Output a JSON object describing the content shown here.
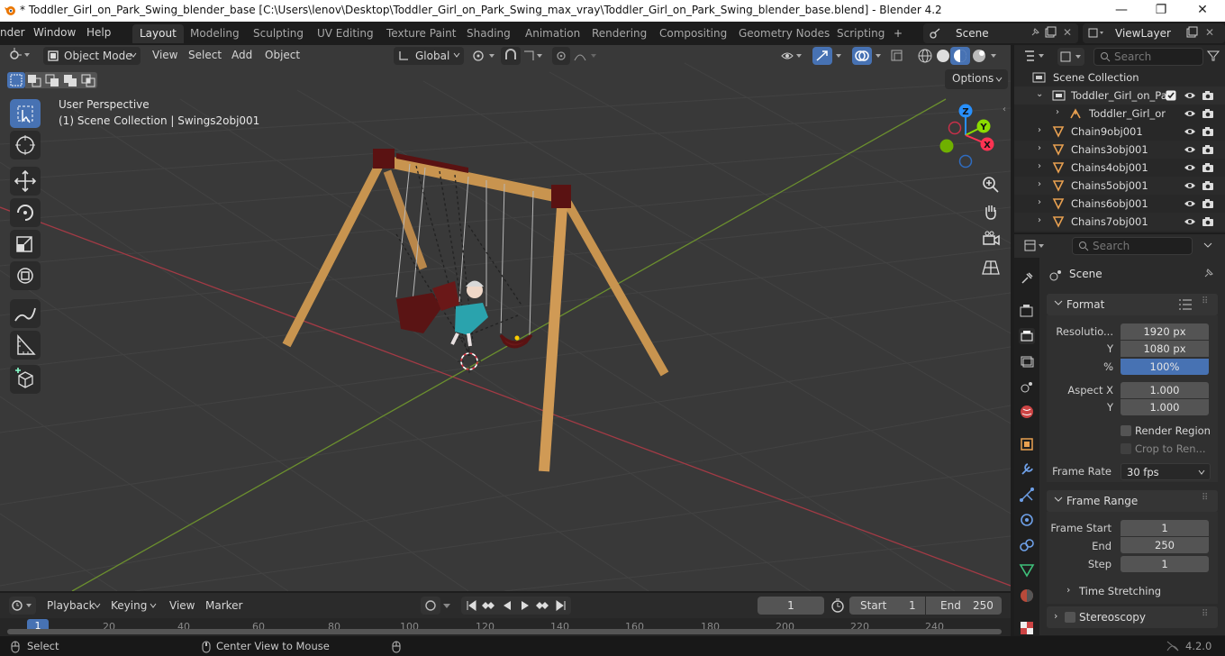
{
  "window": {
    "title": "* Toddler_Girl_on_Park_Swing_blender_base [C:\\Users\\lenov\\Desktop\\Toddler_Girl_on_Park_Swing_max_vray\\Toddler_Girl_on_Park_Swing_blender_base.blend] - Blender 4.2",
    "minimize": "—",
    "maximize": "❐",
    "close": "✕"
  },
  "menubar": {
    "items": [
      "nder",
      "Window",
      "Help"
    ]
  },
  "workspaces": {
    "tabs": [
      "Layout",
      "Modeling",
      "Sculpting",
      "UV Editing",
      "Texture Paint",
      "Shading",
      "Animation",
      "Rendering",
      "Compositing",
      "Geometry Nodes",
      "Scripting"
    ],
    "active": "Layout",
    "add": "+"
  },
  "scene_selector": {
    "value": "Scene"
  },
  "viewlayer_selector": {
    "value": "ViewLayer"
  },
  "viewport": {
    "mode": "Object Mode",
    "menus": [
      "View",
      "Select",
      "Add",
      "Object"
    ],
    "orientation": "Global",
    "options_label": "Options",
    "overlay_text": {
      "perspective": "User Perspective",
      "collection": "(1) Scene Collection | Swings2obj001"
    },
    "gizmo_axes": {
      "z": "Z",
      "y": "Y",
      "x": "X"
    }
  },
  "outliner": {
    "search_placeholder": "Search",
    "root": "Scene Collection",
    "rows": [
      {
        "label": "Toddler_Girl_on_Pa",
        "type": "collection",
        "indent": 1
      },
      {
        "label": "Toddler_Girl_or",
        "type": "armature",
        "indent": 2
      },
      {
        "label": "Chain9obj001",
        "type": "mesh",
        "indent": 1
      },
      {
        "label": "Chains3obj001",
        "type": "mesh",
        "indent": 1
      },
      {
        "label": "Chains4obj001",
        "type": "mesh",
        "indent": 1
      },
      {
        "label": "Chains5obj001",
        "type": "mesh",
        "indent": 1
      },
      {
        "label": "Chains6obj001",
        "type": "mesh",
        "indent": 1
      },
      {
        "label": "Chains7obj001",
        "type": "mesh",
        "indent": 1
      }
    ]
  },
  "properties": {
    "search_placeholder": "Search",
    "context": "Scene",
    "format": {
      "title": "Format",
      "resolution_label": "Resolutio...",
      "resolution_x": "1920 px",
      "y_label": "Y",
      "resolution_y": "1080 px",
      "pct_label": "%",
      "resolution_pct": "100%",
      "aspect_x_label": "Aspect X",
      "aspect_x": "1.000",
      "aspect_y_label": "Y",
      "aspect_y": "1.000",
      "render_region": "Render Region",
      "crop": "Crop to Ren...",
      "frame_rate_label": "Frame Rate",
      "frame_rate": "30 fps"
    },
    "frame_range": {
      "title": "Frame Range",
      "start_label": "Frame Start",
      "start": "1",
      "end_label": "End",
      "end": "250",
      "step_label": "Step",
      "step": "1"
    },
    "time_stretching": "Time Stretching",
    "stereoscopy": "Stereoscopy"
  },
  "timeline": {
    "menus": [
      "Playback",
      "Keying",
      "View",
      "Marker"
    ],
    "current_frame": "1",
    "start_label": "Start",
    "start": "1",
    "end_label": "End",
    "end": "250",
    "ruler": [
      "1",
      "20",
      "40",
      "60",
      "80",
      "100",
      "120",
      "140",
      "160",
      "180",
      "200",
      "220",
      "240"
    ]
  },
  "statusbar": {
    "select": "Select",
    "center": "Center View to Mouse",
    "version": "4.2.0"
  },
  "colors": {
    "accent": "#4772b3",
    "x_axis": "#ff3352",
    "y_axis": "#8bdc00",
    "z_axis": "#2890ff",
    "wood": "#c8944f",
    "metal": "#6a1515"
  }
}
